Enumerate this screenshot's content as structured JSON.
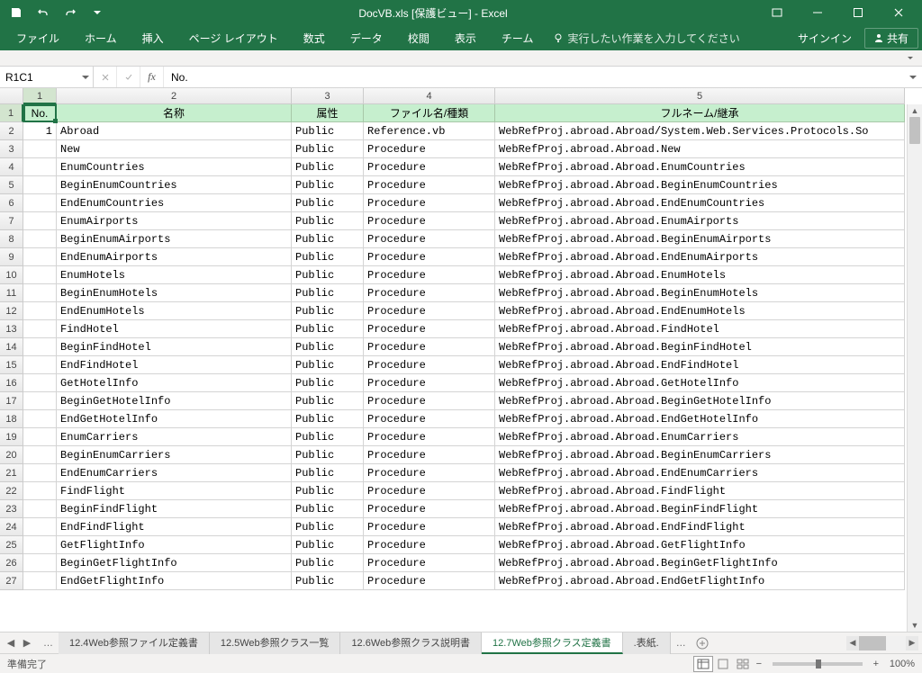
{
  "title": "DocVB.xls [保護ビュー] - Excel",
  "qat": {
    "save": "save",
    "undo": "undo",
    "redo": "redo"
  },
  "ribbon": {
    "tabs": [
      "ファイル",
      "ホーム",
      "挿入",
      "ページ レイアウト",
      "数式",
      "データ",
      "校閲",
      "表示",
      "チーム"
    ],
    "tell_me": "実行したい作業を入力してください",
    "sign_in": "サインイン",
    "share": "共有"
  },
  "formula_bar": {
    "name_box": "R1C1",
    "formula": "No."
  },
  "col_numbers": [
    "1",
    "2",
    "3",
    "4",
    "5"
  ],
  "headers": {
    "no": "No.",
    "name": "名称",
    "attr": "属性",
    "file": "ファイル名/種類",
    "full": "フルネーム/継承"
  },
  "rows": [
    {
      "no": "1",
      "name": "Abroad",
      "attr": "Public",
      "file": "Reference.vb",
      "full": "WebRefProj.abroad.Abroad/System.Web.Services.Protocols.So"
    },
    {
      "no": "",
      "name": "New",
      "attr": "Public",
      "file": "Procedure",
      "full": "WebRefProj.abroad.Abroad.New"
    },
    {
      "no": "",
      "name": "EnumCountries",
      "attr": "Public",
      "file": "Procedure",
      "full": "WebRefProj.abroad.Abroad.EnumCountries"
    },
    {
      "no": "",
      "name": "BeginEnumCountries",
      "attr": "Public",
      "file": "Procedure",
      "full": "WebRefProj.abroad.Abroad.BeginEnumCountries"
    },
    {
      "no": "",
      "name": "EndEnumCountries",
      "attr": "Public",
      "file": "Procedure",
      "full": "WebRefProj.abroad.Abroad.EndEnumCountries"
    },
    {
      "no": "",
      "name": "EnumAirports",
      "attr": "Public",
      "file": "Procedure",
      "full": "WebRefProj.abroad.Abroad.EnumAirports"
    },
    {
      "no": "",
      "name": "BeginEnumAirports",
      "attr": "Public",
      "file": "Procedure",
      "full": "WebRefProj.abroad.Abroad.BeginEnumAirports"
    },
    {
      "no": "",
      "name": "EndEnumAirports",
      "attr": "Public",
      "file": "Procedure",
      "full": "WebRefProj.abroad.Abroad.EndEnumAirports"
    },
    {
      "no": "",
      "name": "EnumHotels",
      "attr": "Public",
      "file": "Procedure",
      "full": "WebRefProj.abroad.Abroad.EnumHotels"
    },
    {
      "no": "",
      "name": "BeginEnumHotels",
      "attr": "Public",
      "file": "Procedure",
      "full": "WebRefProj.abroad.Abroad.BeginEnumHotels"
    },
    {
      "no": "",
      "name": "EndEnumHotels",
      "attr": "Public",
      "file": "Procedure",
      "full": "WebRefProj.abroad.Abroad.EndEnumHotels"
    },
    {
      "no": "",
      "name": "FindHotel",
      "attr": "Public",
      "file": "Procedure",
      "full": "WebRefProj.abroad.Abroad.FindHotel"
    },
    {
      "no": "",
      "name": "BeginFindHotel",
      "attr": "Public",
      "file": "Procedure",
      "full": "WebRefProj.abroad.Abroad.BeginFindHotel"
    },
    {
      "no": "",
      "name": "EndFindHotel",
      "attr": "Public",
      "file": "Procedure",
      "full": "WebRefProj.abroad.Abroad.EndFindHotel"
    },
    {
      "no": "",
      "name": "GetHotelInfo",
      "attr": "Public",
      "file": "Procedure",
      "full": "WebRefProj.abroad.Abroad.GetHotelInfo"
    },
    {
      "no": "",
      "name": "BeginGetHotelInfo",
      "attr": "Public",
      "file": "Procedure",
      "full": "WebRefProj.abroad.Abroad.BeginGetHotelInfo"
    },
    {
      "no": "",
      "name": "EndGetHotelInfo",
      "attr": "Public",
      "file": "Procedure",
      "full": "WebRefProj.abroad.Abroad.EndGetHotelInfo"
    },
    {
      "no": "",
      "name": "EnumCarriers",
      "attr": "Public",
      "file": "Procedure",
      "full": "WebRefProj.abroad.Abroad.EnumCarriers"
    },
    {
      "no": "",
      "name": "BeginEnumCarriers",
      "attr": "Public",
      "file": "Procedure",
      "full": "WebRefProj.abroad.Abroad.BeginEnumCarriers"
    },
    {
      "no": "",
      "name": "EndEnumCarriers",
      "attr": "Public",
      "file": "Procedure",
      "full": "WebRefProj.abroad.Abroad.EndEnumCarriers"
    },
    {
      "no": "",
      "name": "FindFlight",
      "attr": "Public",
      "file": "Procedure",
      "full": "WebRefProj.abroad.Abroad.FindFlight"
    },
    {
      "no": "",
      "name": "BeginFindFlight",
      "attr": "Public",
      "file": "Procedure",
      "full": "WebRefProj.abroad.Abroad.BeginFindFlight"
    },
    {
      "no": "",
      "name": "EndFindFlight",
      "attr": "Public",
      "file": "Procedure",
      "full": "WebRefProj.abroad.Abroad.EndFindFlight"
    },
    {
      "no": "",
      "name": "GetFlightInfo",
      "attr": "Public",
      "file": "Procedure",
      "full": "WebRefProj.abroad.Abroad.GetFlightInfo"
    },
    {
      "no": "",
      "name": "BeginGetFlightInfo",
      "attr": "Public",
      "file": "Procedure",
      "full": "WebRefProj.abroad.Abroad.BeginGetFlightInfo"
    },
    {
      "no": "",
      "name": "EndGetFlightInfo",
      "attr": "Public",
      "file": "Procedure",
      "full": "WebRefProj.abroad.Abroad.EndGetFlightInfo"
    }
  ],
  "sheet_tabs": [
    "12.4Web参照ファイル定義書",
    "12.5Web参照クラス一覧",
    "12.6Web参照クラス説明書",
    "12.7Web参照クラス定義書",
    ".表紙."
  ],
  "active_sheet_index": 3,
  "statusbar": {
    "ready": "準備完了",
    "zoom": "100%"
  }
}
